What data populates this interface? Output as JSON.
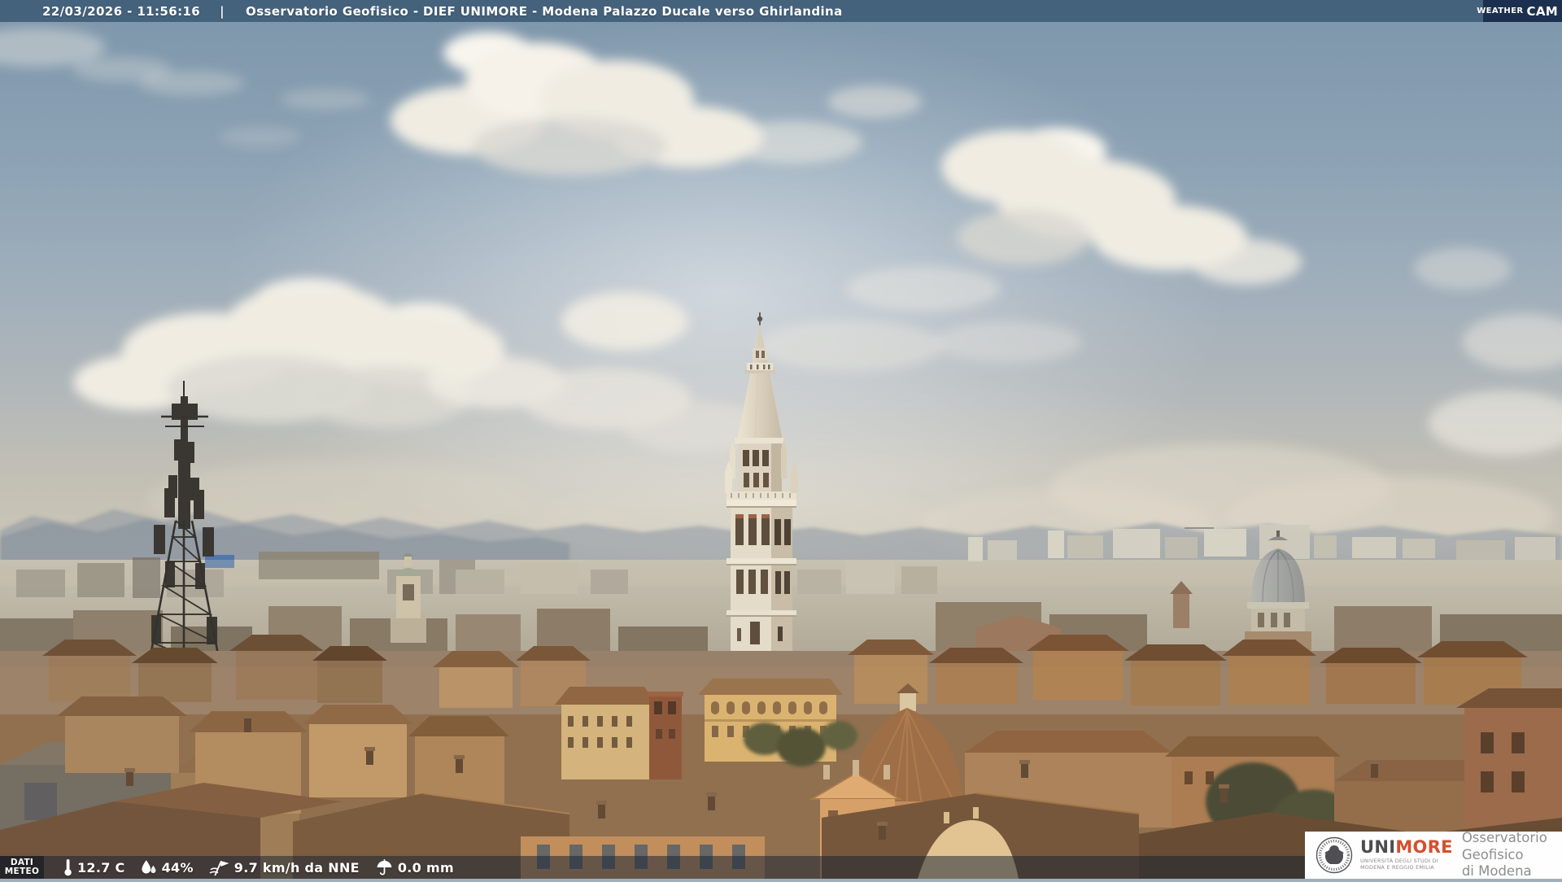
{
  "header": {
    "timestamp": "22/03/2026 - 11:56:16",
    "separator": "|",
    "title": "Osservatorio Geofisico - DIEF UNIMORE - Modena Palazzo Ducale verso Ghirlandina"
  },
  "weathercam_logo": {
    "word1": "Weather",
    "word2": "Cam"
  },
  "weather_bar": {
    "label_line1": "DATI",
    "label_line2": "METEO",
    "temperature": "12.7 C",
    "humidity": "44%",
    "wind": "9.7 km/h da NNE",
    "rain": "0.0 mm"
  },
  "branding": {
    "unimore_uni": "UNI",
    "unimore_more": "MORE",
    "university_line1": "UNIVERSITÀ DEGLI STUDI DI",
    "university_line2": "MODENA E REGGIO EMILIA",
    "observatory_line1": "Osservatorio Geofisico",
    "observatory_line2": "di Modena"
  },
  "colors": {
    "top_bar": "#2f4d6b",
    "weathercam_bg": "#1b2f4e",
    "unimore_red": "#d3502e",
    "unimore_gray": "#4d4d4f",
    "observatory_gray": "#8e8e8e",
    "overlay_text": "#ffffff"
  },
  "scene": {
    "description": "Modena rooftops with Ghirlandina tower and telecom mast under hazy spring sky"
  }
}
